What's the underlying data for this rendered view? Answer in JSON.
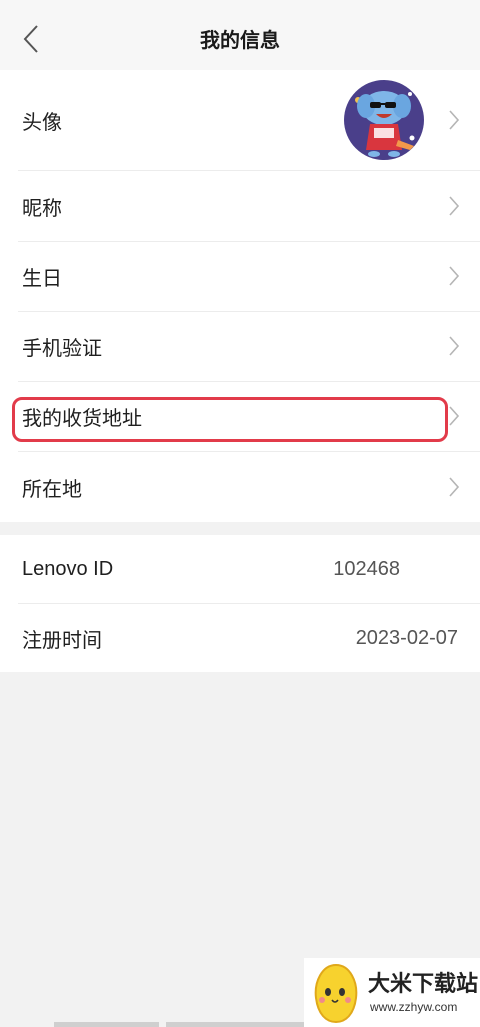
{
  "header": {
    "title": "我的信息"
  },
  "profile_rows": [
    {
      "label": "头像"
    },
    {
      "label": "昵称"
    },
    {
      "label": "生日"
    },
    {
      "label": "手机验证"
    },
    {
      "label": "我的收货地址"
    },
    {
      "label": "所在地"
    }
  ],
  "info_rows": [
    {
      "label": "Lenovo ID",
      "value": "102468"
    },
    {
      "label": "注册时间",
      "value": "2023-02-07"
    }
  ],
  "colors": {
    "highlight": "#e23b4a",
    "background": "#f2f2f2"
  },
  "watermark": {
    "name": "大米下载站",
    "url": "www.zzhyw.com"
  }
}
